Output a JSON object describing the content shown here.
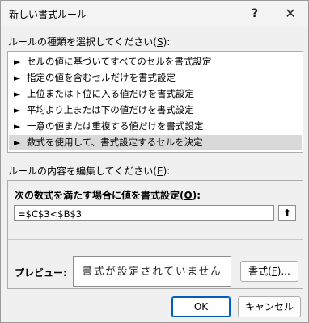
{
  "window": {
    "title": "新しい書式ルール",
    "help_glyph": "?",
    "close_glyph": "✕"
  },
  "rule_type": {
    "label": "ルールの種類を選択してください(",
    "mnemonic": "S",
    "label_suffix": "):",
    "items": [
      {
        "arrow": "►",
        "label": "セルの値に基づいてすべてのセルを書式設定",
        "selected": false
      },
      {
        "arrow": "►",
        "label": "指定の値を含むセルだけを書式設定",
        "selected": false
      },
      {
        "arrow": "►",
        "label": "上位または下位に入る値だけを書式設定",
        "selected": false
      },
      {
        "arrow": "►",
        "label": "平均より上または下の値だけを書式設定",
        "selected": false
      },
      {
        "arrow": "►",
        "label": "一意の値または重複する値だけを書式設定",
        "selected": false
      },
      {
        "arrow": "►",
        "label": "数式を使用して、書式設定するセルを決定",
        "selected": true
      }
    ]
  },
  "rule_content": {
    "label": "ルールの内容を編集してください(",
    "mnemonic": "E",
    "label_suffix": "):",
    "formula_heading": "次の数式を満たす場合に値を書式設定(",
    "formula_mnemonic": "O",
    "formula_heading_suffix": "):",
    "formula_value": "=$C$3<$B$3",
    "collapse_icon": "⬆",
    "preview_label": "プレビュー:",
    "preview_text": "書式が設定されていません",
    "format_button_prefix": "書式(",
    "format_button_mnemonic": "F",
    "format_button_suffix": ")..."
  },
  "buttons": {
    "ok": "OK",
    "cancel": "キャンセル"
  }
}
